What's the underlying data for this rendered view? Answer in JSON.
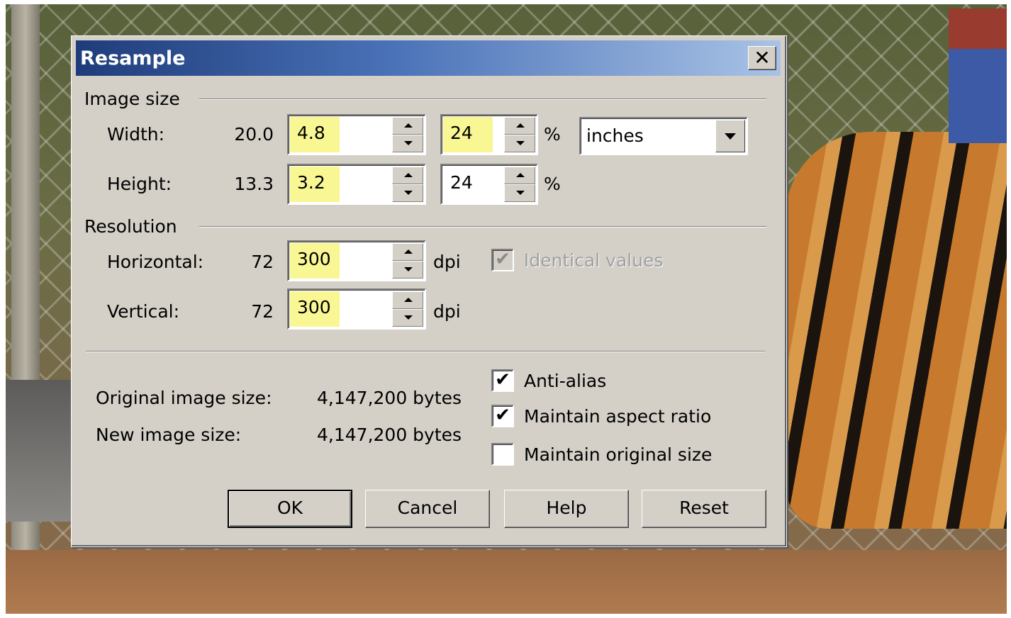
{
  "dialog": {
    "title": "Resample",
    "close_glyph": "✕"
  },
  "image_size": {
    "group_label": "Image size",
    "width_label": "Width:",
    "width_original": "20.0",
    "width_value": "4.8",
    "width_percent": "24",
    "height_label": "Height:",
    "height_original": "13.3",
    "height_value": "3.2",
    "height_percent": "24",
    "percent_unit": "%",
    "units_selected": "inches"
  },
  "resolution": {
    "group_label": "Resolution",
    "horizontal_label": "Horizontal:",
    "horizontal_original": "72",
    "horizontal_value": "300",
    "vertical_label": "Vertical:",
    "vertical_original": "72",
    "vertical_value": "300",
    "unit": "dpi",
    "identical_label": "Identical values",
    "identical_checked": true
  },
  "info": {
    "original_label": "Original image size:",
    "original_value": "4,147,200 bytes",
    "new_label": "New image size:",
    "new_value": "4,147,200 bytes"
  },
  "options": {
    "anti_alias_label": "Anti-alias",
    "anti_alias_checked": true,
    "aspect_label": "Maintain aspect ratio",
    "aspect_checked": true,
    "original_size_label": "Maintain original size",
    "original_size_checked": false,
    "check_glyph": "✔"
  },
  "buttons": {
    "ok": "OK",
    "cancel": "Cancel",
    "help": "Help",
    "reset": "Reset"
  },
  "colors": {
    "highlight": "#f9f793",
    "face": "#d4d0c8",
    "title_start": "#1e3c7a",
    "title_end": "#a9c3e6"
  }
}
